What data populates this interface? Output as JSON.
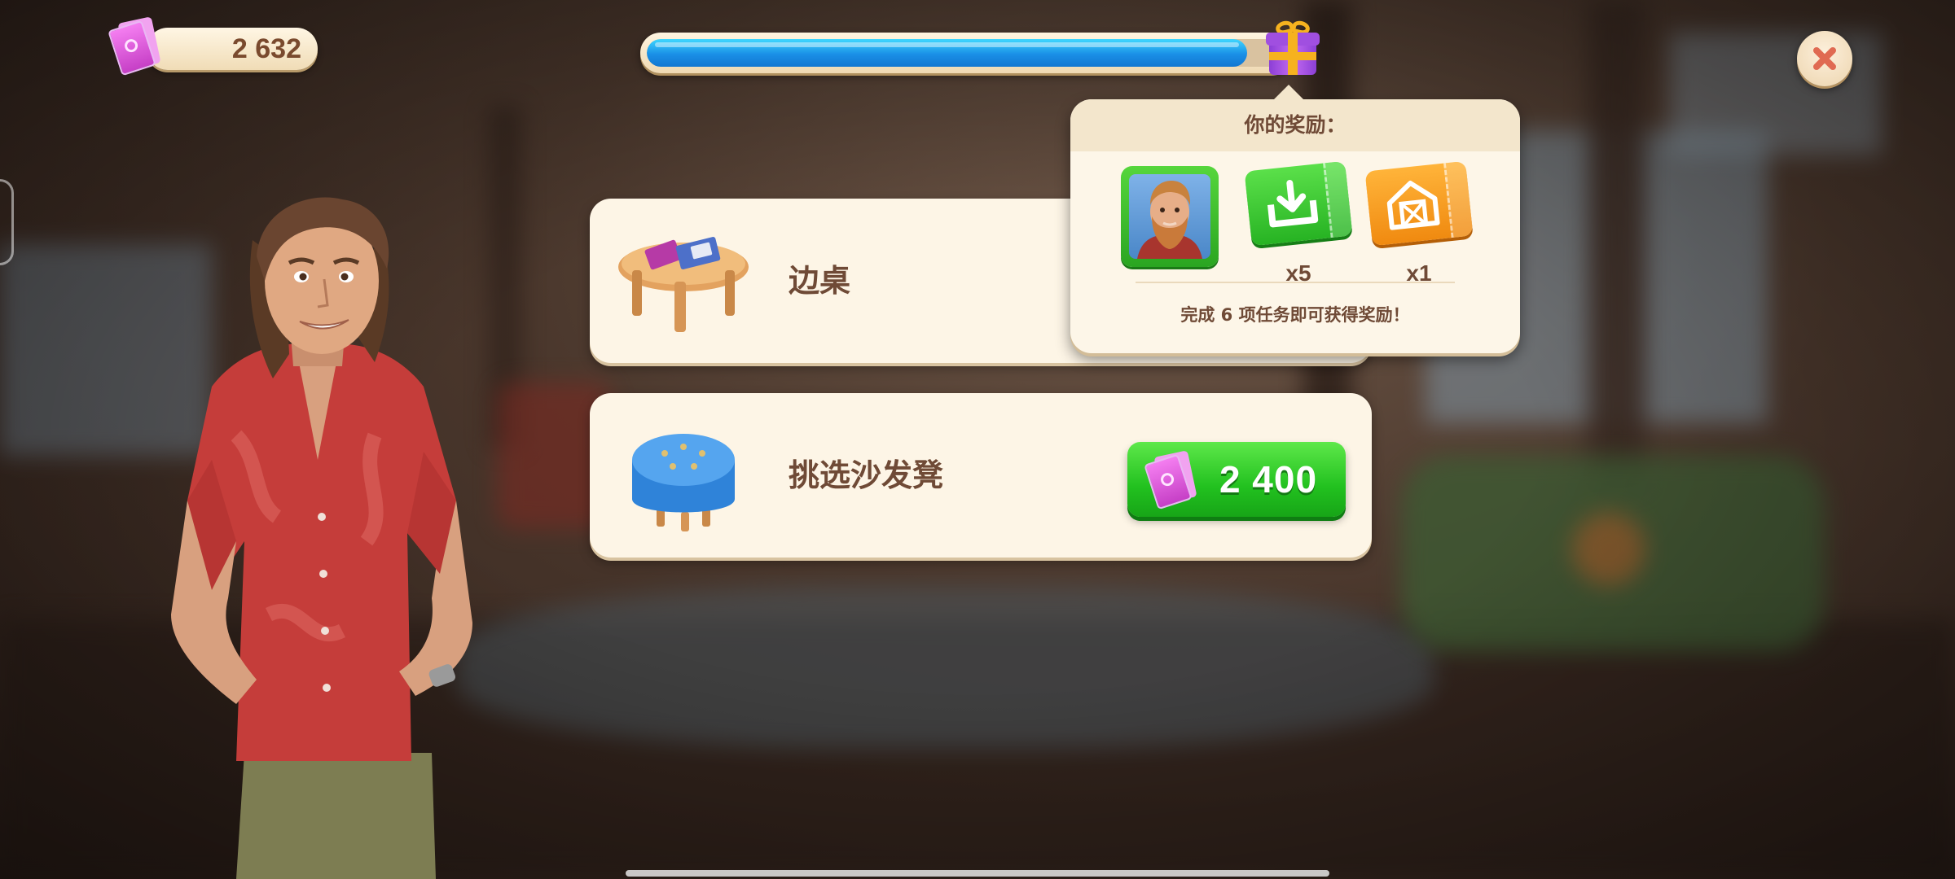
{
  "currency": {
    "amount": "2 632",
    "icon": "ticket-icon"
  },
  "progress": {
    "fraction": 0.94,
    "reward_icon": "gift-box-icon"
  },
  "close": {
    "icon": "close-icon"
  },
  "tasks": [
    {
      "label": "边桌",
      "icon": "side-table-icon"
    },
    {
      "label": "挑选沙发凳",
      "icon": "blue-ottoman-icon",
      "price": "2 400",
      "price_icon": "ticket-icon"
    }
  ],
  "reward_popup": {
    "title": "你的奖励：",
    "rewards": [
      {
        "icon": "bearded-man-portrait-icon",
        "count": ""
      },
      {
        "icon": "download-coupon-icon",
        "count": "x5"
      },
      {
        "icon": "barn-coupon-icon",
        "count": "x1"
      }
    ],
    "footer": "完成 6 项任务即可获得奖励！"
  },
  "colors": {
    "accent_green": "#22c11f",
    "progress_blue": "#1a8fe6",
    "card_bg": "#fdf5e6",
    "text_brown": "#6f4a36"
  }
}
